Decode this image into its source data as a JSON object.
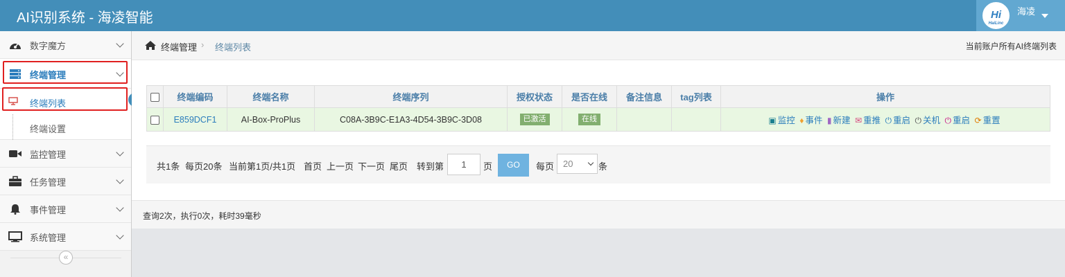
{
  "header": {
    "title": "AI识别系统 - 海凌智能",
    "user_name": "海凌",
    "avatar_text": "Hi",
    "avatar_subtext": "HaiLinc"
  },
  "sidebar": {
    "items": [
      {
        "label": "数字魔方",
        "icon": "dashboard-icon"
      },
      {
        "label": "终端管理",
        "icon": "server-icon"
      },
      {
        "label": "监控管理",
        "icon": "video-camera-icon"
      },
      {
        "label": "任务管理",
        "icon": "briefcase-icon"
      },
      {
        "label": "事件管理",
        "icon": "bell-icon"
      },
      {
        "label": "系统管理",
        "icon": "desktop-icon"
      }
    ],
    "submenu": [
      {
        "label": "终端列表",
        "icon": "monitor-icon"
      },
      {
        "label": "终端设置"
      }
    ],
    "collapse_glyph": "«"
  },
  "breadcrumb": {
    "home": "终端管理",
    "separator": "›",
    "current": "终端列表",
    "right_note": "当前账户所有AI终端列表"
  },
  "table": {
    "headers": [
      "终端编码",
      "终端名称",
      "终端序列",
      "授权状态",
      "是否在线",
      "备注信息",
      "tag列表",
      "操作"
    ],
    "rows": [
      {
        "code": "E859DCF1",
        "name": "AI-Box-ProPlus",
        "serial": "C08A-3B9C-E1A3-4D54-3B9C-3D08",
        "auth_status": "已激活",
        "online": "在线",
        "remark": "",
        "tags": "",
        "ops": [
          "监控",
          "事件",
          "新建",
          "重推",
          "重启",
          "关机",
          "重启",
          "重置"
        ]
      }
    ]
  },
  "pager": {
    "total": "共1条",
    "per_page": "每页20条",
    "current": "当前第1页/共1页",
    "first": "首页",
    "prev": "上一页",
    "next": "下一页",
    "last": "尾页",
    "goto_prefix": "转到第",
    "goto_value": "1",
    "goto_suffix": "页",
    "go_label": "GO",
    "size_prefix": "每页",
    "size_value": "20",
    "size_suffix": "条"
  },
  "footer": {
    "stats": "查询2次，执行0次，耗时39毫秒"
  },
  "colors": {
    "header_bg": "#438eb9",
    "user_bg": "#62a8d1",
    "row_bg": "#e9f7e2",
    "badge_green": "#82af6f",
    "highlight_red": "#e02020",
    "link_blue": "#2b7dbc"
  }
}
